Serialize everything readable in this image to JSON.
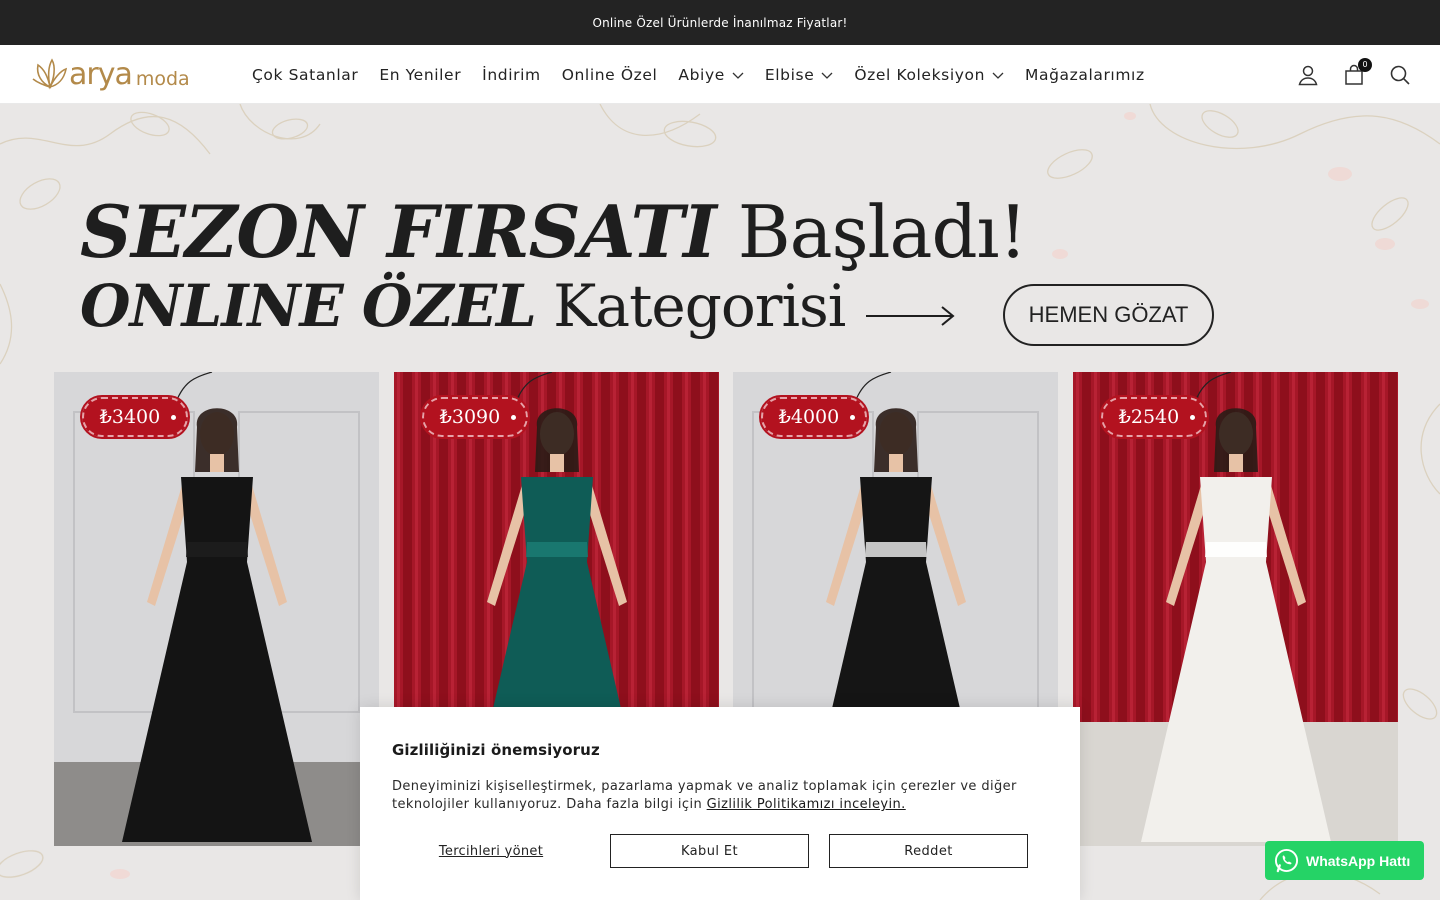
{
  "announcement": "Online Özel Ürünlerde İnanılmaz Fiyatlar!",
  "logo": {
    "word": "arya",
    "sub": "moda",
    "color": "#b38a4a"
  },
  "nav": [
    {
      "label": "Çok Satanlar",
      "dropdown": false
    },
    {
      "label": "En Yeniler",
      "dropdown": false
    },
    {
      "label": "İndirim",
      "dropdown": false
    },
    {
      "label": "Online Özel",
      "dropdown": false
    },
    {
      "label": "Abiye",
      "dropdown": true
    },
    {
      "label": "Elbise",
      "dropdown": true
    },
    {
      "label": "Özel Koleksiyon",
      "dropdown": true
    },
    {
      "label": "Mağazalarımız",
      "dropdown": false
    }
  ],
  "header_icons": [
    "user-icon",
    "cart-icon",
    "search-icon"
  ],
  "cart_count": "0",
  "hero": {
    "line1_bold": "SEZON FIRSATI",
    "line1_rest": " Başladı!",
    "line2_bold": "ONLINE ÖZEL",
    "line2_rest": " Kategorisi",
    "button": "HEMEN GÖZAT",
    "products": [
      {
        "price": "₺3400",
        "backdrop": "panel",
        "dress": "#141414",
        "accent": "#1d1d1d"
      },
      {
        "price": "₺3090",
        "backdrop": "curtain",
        "dress": "#0f5c56",
        "accent": "#1b7a72"
      },
      {
        "price": "₺4000",
        "backdrop": "panel",
        "dress": "#151515",
        "accent": "#d8d8d8"
      },
      {
        "price": "₺2540",
        "backdrop": "curtain",
        "dress": "#f2f0ec",
        "accent": "#ffffff"
      }
    ]
  },
  "cookie": {
    "title": "Gizliliğinizi önemsiyoruz",
    "text": "Deneyiminizi kişiselleştirmek, pazarlama yapmak ve analiz toplamak için çerezler ve diğer teknolojiler kullanıyoruz. Daha fazla bilgi için ",
    "link": "Gizlilik Politikamızı inceleyin.",
    "manage": "Tercihleri yönet",
    "accept": "Kabul Et",
    "reject": "Reddet"
  },
  "whatsapp": {
    "label": "WhatsApp Hattı",
    "color": "#25d366"
  }
}
